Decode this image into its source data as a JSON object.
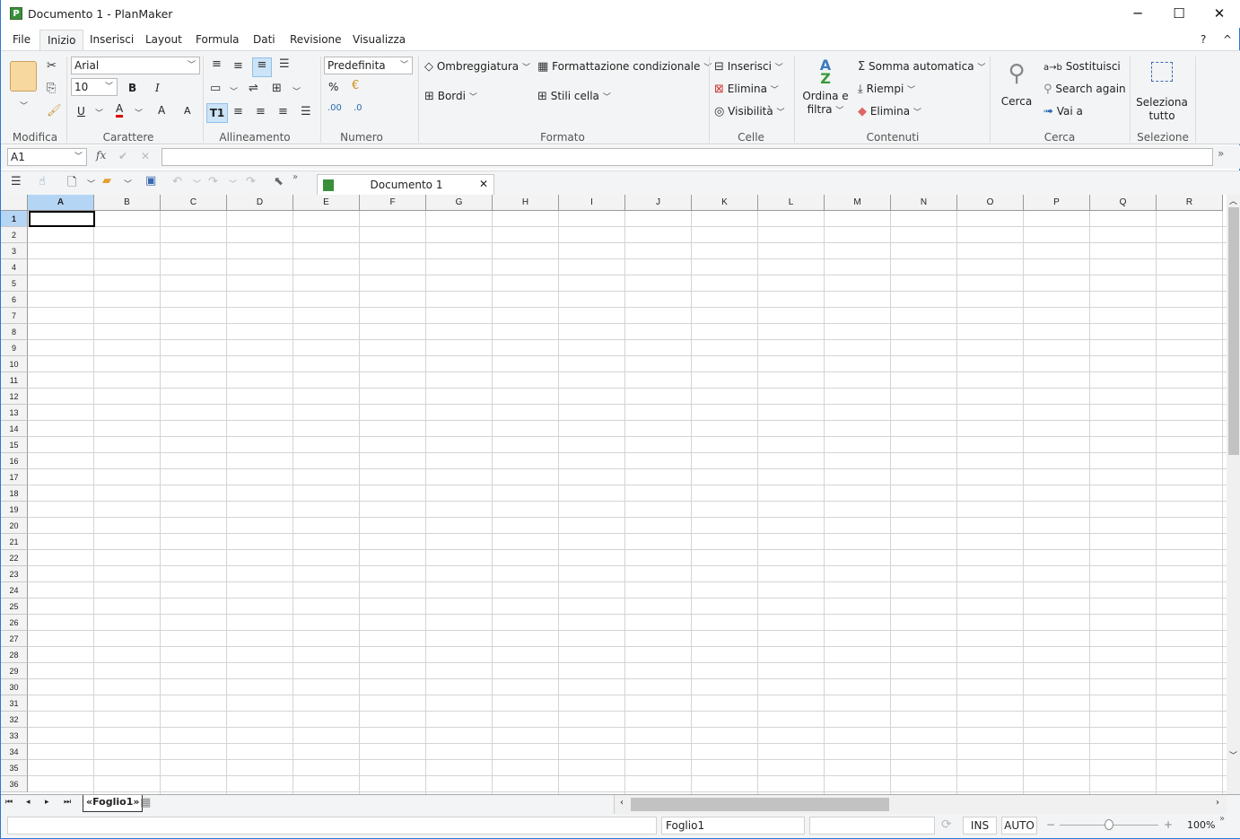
{
  "window": {
    "title": "Documento 1 - PlanMaker",
    "app_icon": "P",
    "minimize": "─",
    "maximize": "☐",
    "close": "✕"
  },
  "menu": {
    "tabs": [
      "File",
      "Inizio",
      "Inserisci",
      "Layout",
      "Formula",
      "Dati",
      "Revisione",
      "Visualizza"
    ],
    "active": "Inizio",
    "help": "?",
    "collapse": "^"
  },
  "ribbon": {
    "modifica": {
      "label": "Modifica"
    },
    "carattere": {
      "label": "Carattere",
      "font": "Arial",
      "size": "10",
      "bold": "B",
      "italic": "I",
      "underline": "U",
      "font_color": "A",
      "grow": "A",
      "shrink": "A",
      "font_color_hex": "#e00000"
    },
    "allineamento": {
      "label": "Allineamento",
      "t1": "T1"
    },
    "numero": {
      "label": "Numero",
      "format": "Predefinita",
      "percent": "%"
    },
    "formato": {
      "label": "Formato",
      "ombreggiatura": "Ombreggiatura",
      "formattazione": "Formattazione condizionale",
      "bordi": "Bordi",
      "stili": "Stili cella"
    },
    "celle": {
      "label": "Celle",
      "inserisci": "Inserisci",
      "elimina": "Elimina",
      "visibilita": "Visibilità"
    },
    "contenuti": {
      "label": "Contenuti",
      "ordina1": "Ordina e",
      "ordina2": "filtra",
      "somma": "Somma automatica",
      "riempi": "Riempi",
      "elimina": "Elimina"
    },
    "cerca": {
      "label": "Cerca",
      "cerca": "Cerca",
      "sostituisci": "Sostituisci",
      "search_again": "Search again",
      "vai": "Vai a"
    },
    "selezione": {
      "label": "Selezione",
      "sel1": "Seleziona",
      "sel2": "tutto"
    }
  },
  "formula": {
    "cell_ref": "A1",
    "fx": "fx",
    "value": ""
  },
  "toolbar": {
    "doc_tab": "Documento 1"
  },
  "grid": {
    "columns": [
      "A",
      "B",
      "C",
      "D",
      "E",
      "F",
      "G",
      "H",
      "I",
      "J",
      "K",
      "L",
      "M",
      "N",
      "O",
      "P",
      "Q",
      "R"
    ],
    "rows": [
      "1",
      "2",
      "3",
      "4",
      "5",
      "6",
      "7",
      "8",
      "9",
      "10",
      "11",
      "12",
      "13",
      "14",
      "15",
      "16",
      "17",
      "18",
      "19",
      "20",
      "21",
      "22",
      "23",
      "24",
      "25",
      "26",
      "27",
      "28",
      "29",
      "30",
      "31",
      "32",
      "33",
      "34",
      "35",
      "36"
    ],
    "active_cell": "A1"
  },
  "sheets": {
    "tabs": [
      "«Foglio1»"
    ]
  },
  "status": {
    "sheet": "Foglio1",
    "ins": "INS",
    "auto": "AUTO",
    "zoom": "100%",
    "minus": "−",
    "plus": "+"
  }
}
